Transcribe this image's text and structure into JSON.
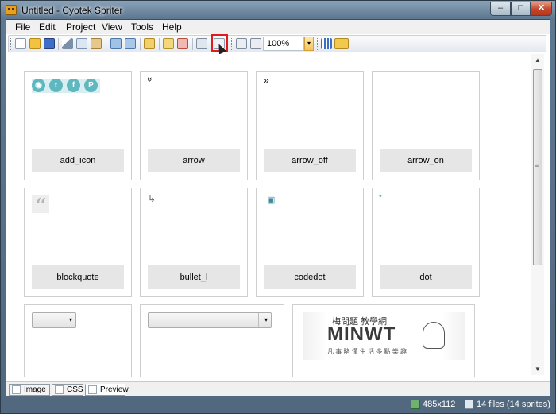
{
  "window": {
    "title": "Untitled - Cyotek Spriter",
    "min_glyph": "–",
    "max_glyph": "□",
    "close_glyph": "✕"
  },
  "menu": [
    "File",
    "Edit",
    "Project",
    "View",
    "Tools",
    "Help"
  ],
  "toolbar": {
    "zoom_value": "100%",
    "dropdown_glyph": "▾"
  },
  "sprites": [
    {
      "label": "add_icon",
      "icon": "social-icons"
    },
    {
      "label": "arrow",
      "icon": "double-chevron-down-icon"
    },
    {
      "label": "arrow_off",
      "icon": "double-chevron-right-icon"
    },
    {
      "label": "arrow_on",
      "icon": "none"
    },
    {
      "label": "blockquote",
      "icon": "quote-icon"
    },
    {
      "label": "bullet_l",
      "icon": "bullet-arrow-icon"
    },
    {
      "label": "codedot",
      "icon": "code-icon"
    },
    {
      "label": "dot",
      "icon": "dot-icon"
    }
  ],
  "social": [
    "◉",
    "t",
    "f",
    "P"
  ],
  "glyphs": {
    "arrow": "»",
    "arrow_off": "»",
    "blockquote": "“",
    "bullet_l": "↳",
    "codedot": "▣",
    "dot": "•"
  },
  "logo": {
    "top_text": "梅問題 教學網",
    "main_text": "MINWT",
    "sub_text": "凡 事 略 懂 生 活 多 點 樂 趣"
  },
  "scrollbar": {
    "up": "▲",
    "down": "▼",
    "grip": "≡"
  },
  "tabs": [
    {
      "label": "Image"
    },
    {
      "label": "CSS"
    },
    {
      "label": "Preview"
    }
  ],
  "status": {
    "size": "485x112",
    "files": "14 files (14 sprites)"
  },
  "colors": {
    "accent": "#5fb8bf",
    "highlight": "#e01b1b"
  }
}
